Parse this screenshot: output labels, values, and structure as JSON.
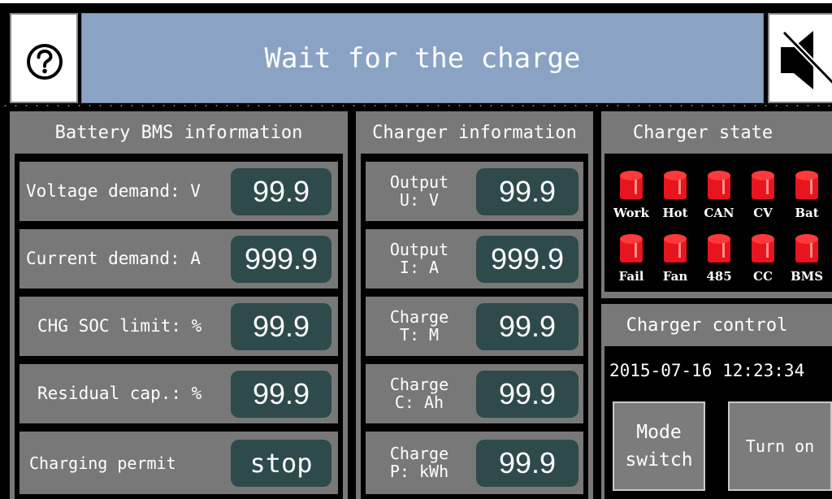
{
  "header": {
    "title": "Wait for the charge",
    "help_icon": "question-circle-icon",
    "mute_icon": "speaker-muted-icon"
  },
  "bms": {
    "title": "Battery BMS information",
    "rows": [
      {
        "label": "Voltage demand: V",
        "value": "99.9"
      },
      {
        "label": "Current demand: A",
        "value": "999.9"
      },
      {
        "label": "CHG SOC limit: %",
        "value": "99.9"
      },
      {
        "label": "Residual cap.: %",
        "value": "99.9"
      },
      {
        "label": "Charging permit",
        "value": "stop"
      }
    ]
  },
  "charger_info": {
    "title": "Charger information",
    "rows": [
      {
        "label_line1": "Output",
        "label_line2": "U: V",
        "value": "99.9"
      },
      {
        "label_line1": "Output",
        "label_line2": "I: A",
        "value": "999.9"
      },
      {
        "label_line1": "Charge",
        "label_line2": "T: M",
        "value": "99.9"
      },
      {
        "label_line1": "Charge",
        "label_line2": "C: Ah",
        "value": "99.9"
      },
      {
        "label_line1": "Charge",
        "label_line2": "P: kWh",
        "value": "99.9"
      }
    ]
  },
  "charger_state": {
    "title": "Charger state",
    "led_color": "#e8141e",
    "indicators_top": [
      "Work",
      "Hot",
      "CAN",
      "CV",
      "Bat"
    ],
    "indicators_bottom": [
      "Fail",
      "Fan",
      "485",
      "CC",
      "BMS"
    ]
  },
  "charger_control": {
    "title": "Charger control",
    "datetime": "2015-07-16 12:23:34",
    "mode_button_line1": "Mode",
    "mode_button_line2": "switch",
    "turn_on_button": "Turn on"
  }
}
